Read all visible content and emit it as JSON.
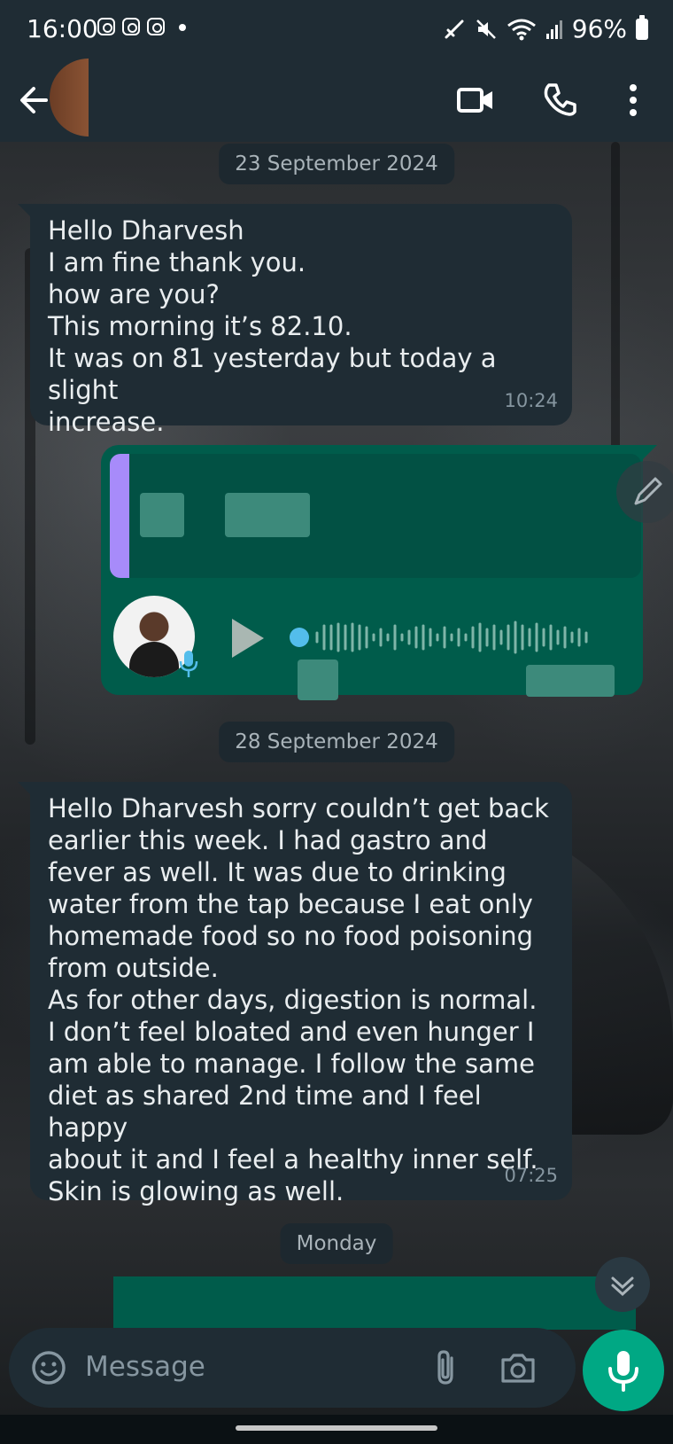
{
  "status_bar": {
    "time": "16:00",
    "battery": "96%"
  },
  "chat": {
    "date_chips": [
      "23 September 2024",
      "28 September 2024",
      "Monday"
    ],
    "messages": [
      {
        "direction": "incoming",
        "lines": [
          "Hello Dharvesh",
          "I am fine thank you.",
          "how are you?",
          "This morning it’s 82.10.",
          "It was on 81 yesterday but today a slight",
          "increase."
        ],
        "time": "10:24"
      },
      {
        "direction": "outgoing",
        "type": "voice_reply"
      },
      {
        "direction": "incoming",
        "lines": [
          "Hello Dharvesh sorry couldn’t get back",
          "earlier this week. I had gastro and",
          "fever as well. It was due to drinking",
          "water from the tap because I eat only",
          "homemade food so no food poisoning",
          "from outside.",
          "As for other days, digestion is normal.",
          "I don’t feel bloated and even hunger I",
          "am able to manage. I follow the same",
          "diet as shared 2nd time and I feel happy",
          "about it and I feel a healthy inner self.",
          "Skin is glowing as well."
        ],
        "time": "07:25"
      }
    ]
  },
  "composer": {
    "placeholder": "Message"
  },
  "icons": {
    "back": "arrow-left-icon",
    "video": "video-camera-icon",
    "call": "phone-icon",
    "menu": "more-vert-icon",
    "emoji": "emoji-icon",
    "attach": "paperclip-icon",
    "camera": "camera-icon",
    "mic": "mic-icon",
    "edit": "pencil-icon",
    "scroll_down": "chevron-down-icon"
  },
  "colors": {
    "header": "#1f2c34",
    "incoming_bubble": "#1f2c34",
    "outgoing_bubble": "#005c4b",
    "accent": "#00a884",
    "timestamp": "#8696a0"
  }
}
